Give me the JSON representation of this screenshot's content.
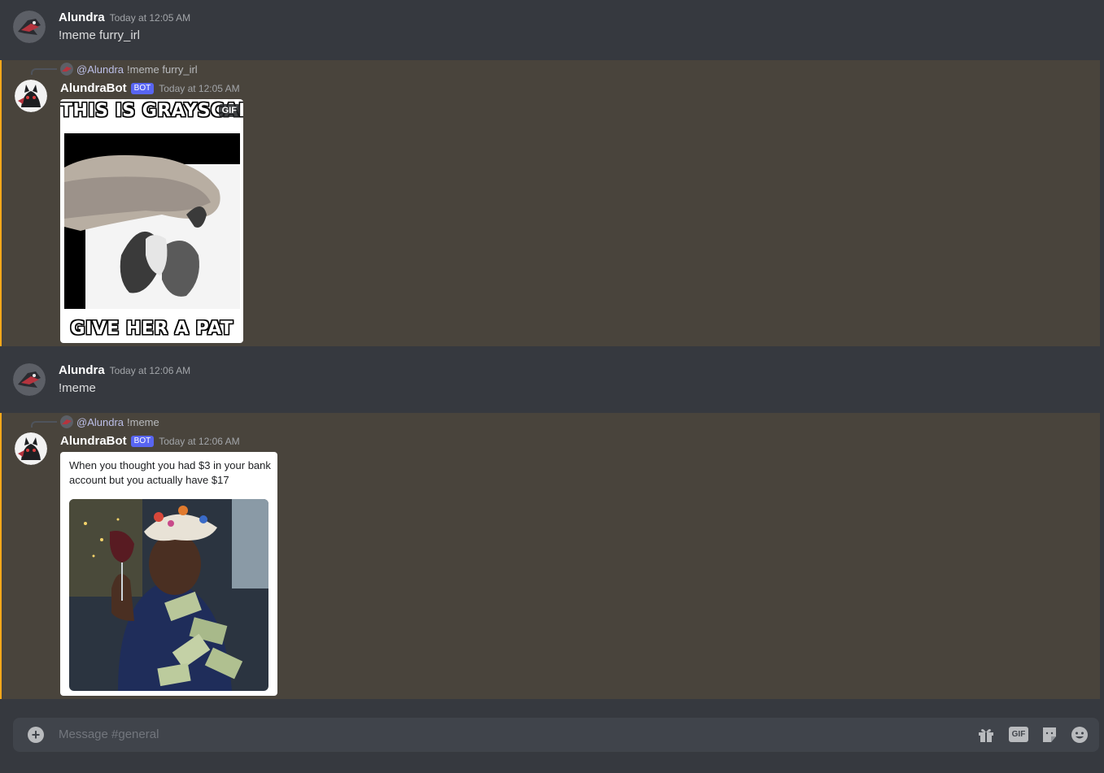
{
  "messages": [
    {
      "username": "Alundra",
      "timestamp": "Today at 12:05 AM",
      "text": "!meme furry_irl"
    },
    {
      "reply_user": "@Alundra",
      "reply_text": "!meme furry_irl",
      "username": "AlundraBot",
      "bot_tag": "BOT",
      "timestamp": "Today at 12:05 AM",
      "attachment": {
        "top_text": "THIS IS GRAYSCALE",
        "bottom_text": "GIVE HER A PAT",
        "badge": "GIF"
      }
    },
    {
      "username": "Alundra",
      "timestamp": "Today at 12:06 AM",
      "text": "!meme"
    },
    {
      "reply_user": "@Alundra",
      "reply_text": "!meme",
      "username": "AlundraBot",
      "bot_tag": "BOT",
      "timestamp": "Today at 12:06 AM",
      "attachment": {
        "caption": "When you thought you had $3 in your bank account but you actually have $17"
      }
    }
  ],
  "composer": {
    "placeholder": "Message #general",
    "gif_label": "GIF"
  },
  "icons": [
    "add-attachment-icon",
    "gift-icon",
    "gif-icon",
    "sticker-icon",
    "emoji-icon"
  ],
  "colors": {
    "background": "#36393f",
    "mention_highlight": "#49443c",
    "mention_bar": "#faa81a",
    "bot_tag": "#5865f2"
  }
}
